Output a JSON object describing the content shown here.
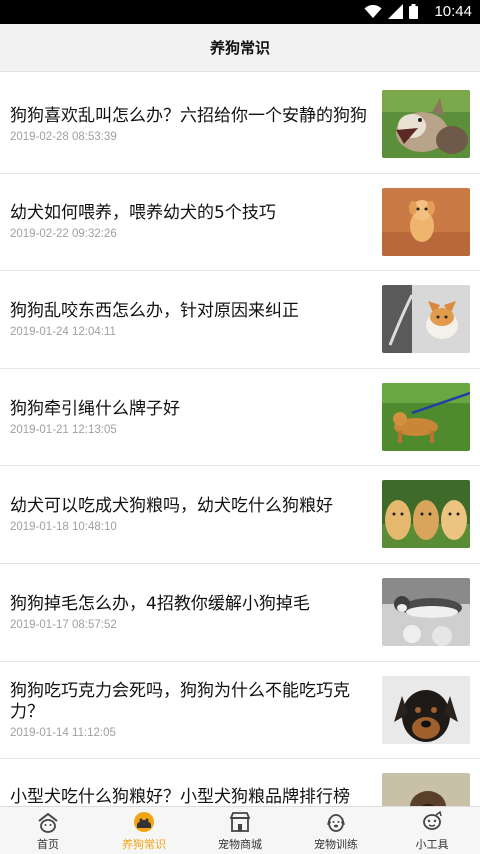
{
  "status_bar": {
    "time": "10:44",
    "icons": [
      "wifi-icon",
      "signal-icon",
      "battery-icon"
    ]
  },
  "header": {
    "title": "养狗常识"
  },
  "articles": [
    {
      "title": "狗狗喜欢乱叫怎么办？六招给你一个安静的狗狗",
      "date": "2019-02-28 08:53:39",
      "thumb": "barking-dog"
    },
    {
      "title": "幼犬如何喂养，喂养幼犬的5个技巧",
      "date": "2019-02-22 09:32:26",
      "thumb": "puppy-walking"
    },
    {
      "title": "狗狗乱咬东西怎么办，针对原因来纠正",
      "date": "2019-01-24 12:04:11",
      "thumb": "corgi"
    },
    {
      "title": "狗狗牵引绳什么牌子好",
      "date": "2019-01-21 12:13:05",
      "thumb": "dog-on-leash"
    },
    {
      "title": "幼犬可以吃成犬狗粮吗，幼犬吃什么狗粮好",
      "date": "2019-01-18 10:48:10",
      "thumb": "golden-puppies"
    },
    {
      "title": "狗狗掉毛怎么办，4招教你缓解小狗掉毛",
      "date": "2019-01-17 08:57:52",
      "thumb": "husky-shedding"
    },
    {
      "title": "狗狗吃巧克力会死吗，狗狗为什么不能吃巧克力？",
      "date": "2019-01-14 11:12:05",
      "thumb": "rottweiler"
    },
    {
      "title": "小型犬吃什么狗粮好？小型犬狗粮品牌排行榜",
      "date": "",
      "thumb": "small-dog"
    }
  ],
  "tabs": [
    {
      "label": "首页",
      "icon": "home-icon",
      "active": false
    },
    {
      "label": "养狗常识",
      "icon": "dog-knowledge-icon",
      "active": true
    },
    {
      "label": "宠物商城",
      "icon": "shop-icon",
      "active": false
    },
    {
      "label": "宠物训练",
      "icon": "training-icon",
      "active": false
    },
    {
      "label": "小工具",
      "icon": "tools-icon",
      "active": false
    }
  ],
  "colors": {
    "accent": "#f2a30f",
    "divider": "#e6e6e6",
    "date_text": "#a0a0a0"
  }
}
